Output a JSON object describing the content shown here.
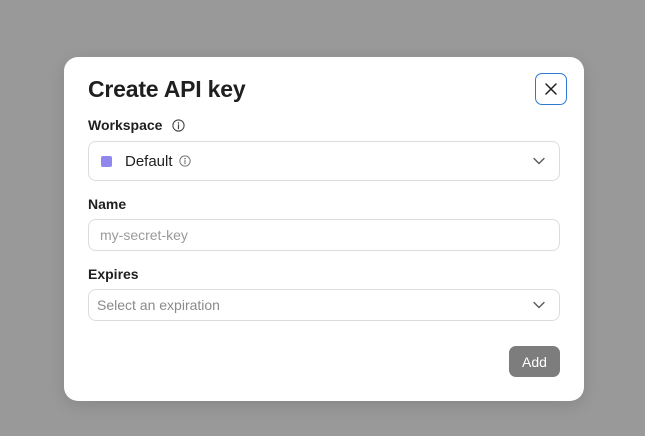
{
  "modal": {
    "title": "Create API key",
    "close_icon": "close-icon"
  },
  "workspace": {
    "label": "Workspace",
    "label_icon": "info-icon",
    "selected": "Default",
    "swatch_color": "#8f86ee",
    "value_icon": "info-icon"
  },
  "name": {
    "label": "Name",
    "value": "",
    "placeholder": "my-secret-key"
  },
  "expires": {
    "label": "Expires",
    "placeholder": "Select an expiration"
  },
  "actions": {
    "add_label": "Add",
    "add_color": "#7d7d7d"
  }
}
